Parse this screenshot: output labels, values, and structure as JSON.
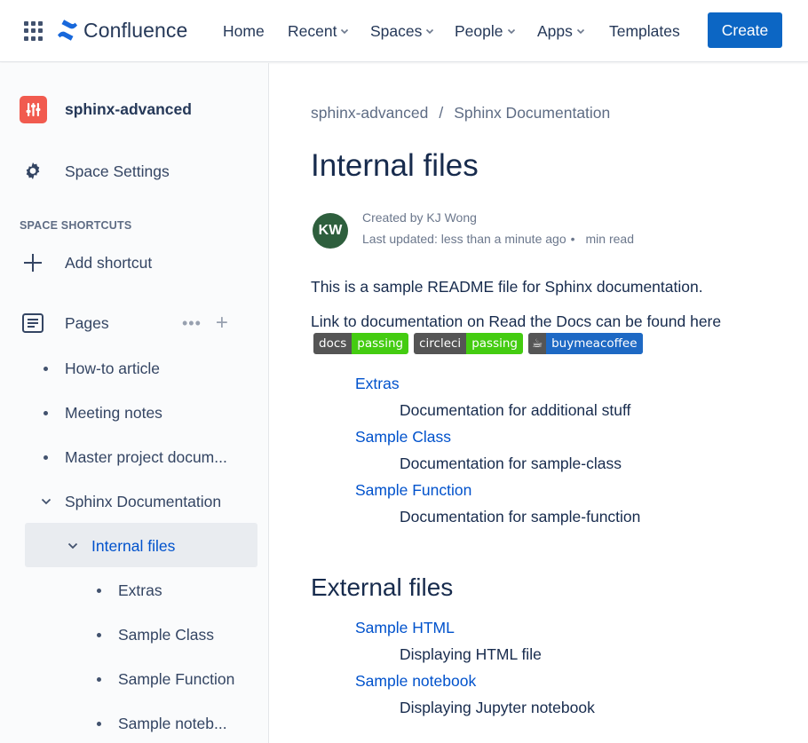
{
  "topnav": {
    "logo_text": "Confluence",
    "items": [
      {
        "label": "Home",
        "has_menu": false
      },
      {
        "label": "Recent",
        "has_menu": true
      },
      {
        "label": "Spaces",
        "has_menu": true
      },
      {
        "label": "People",
        "has_menu": true
      },
      {
        "label": "Apps",
        "has_menu": true
      },
      {
        "label": "Templates",
        "has_menu": false
      }
    ],
    "create_label": "Create",
    "accent": "#0c66c4"
  },
  "sidebar": {
    "space_name": "sphinx-advanced",
    "space_avatar_color": "#f15b4f",
    "space_settings": "Space Settings",
    "shortcuts_header": "SPACE SHORTCUTS",
    "add_shortcut": "Add shortcut",
    "pages_label": "Pages",
    "tree": [
      {
        "label": "How-to article"
      },
      {
        "label": "Meeting notes"
      },
      {
        "label": "Master project docum..."
      },
      {
        "label": "Sphinx Documentation"
      },
      {
        "label": "Internal files"
      },
      {
        "label": "Extras"
      },
      {
        "label": "Sample Class"
      },
      {
        "label": "Sample Function"
      },
      {
        "label": "Sample noteb..."
      }
    ]
  },
  "main": {
    "breadcrumb": [
      "sphinx-advanced",
      "Sphinx Documentation"
    ],
    "breadcrumb_sep": "/",
    "title": "Internal files",
    "author_initials": "KW",
    "created_by": "Created by KJ Wong",
    "last_updated": "Last updated: less than a minute ago",
    "meta_dot": "•",
    "read_time": "min read",
    "intro": "This is a sample README file for Sphinx documentation.",
    "link_line": "Link to documentation on Read the Docs can be found here",
    "badges": [
      {
        "left": "docs",
        "right": "passing"
      },
      {
        "left": "circleci",
        "right": "passing"
      },
      {
        "left": "☕",
        "right": "buymeacoffee"
      }
    ],
    "internal_list": [
      {
        "term": "Extras",
        "desc": "Documentation for additional stuff"
      },
      {
        "term": "Sample Class",
        "desc": "Documentation for sample-class"
      },
      {
        "term": "Sample Function",
        "desc": "Documentation for sample-function"
      }
    ],
    "external_heading": "External files",
    "external_list": [
      {
        "term": "Sample HTML",
        "desc": "Displaying HTML file"
      },
      {
        "term": "Sample notebook",
        "desc": "Displaying Jupyter notebook"
      }
    ]
  }
}
